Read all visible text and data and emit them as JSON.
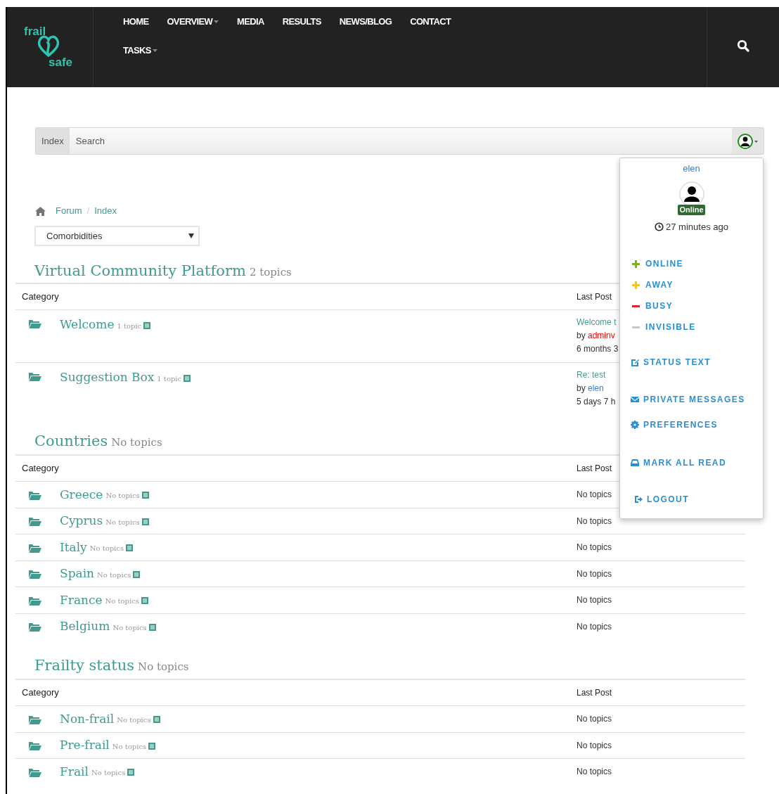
{
  "nav": {
    "items": [
      {
        "label": "HOME",
        "caret": false
      },
      {
        "label": "OVERVIEW",
        "caret": true
      },
      {
        "label": "MEDIA",
        "caret": false
      },
      {
        "label": "RESULTS",
        "caret": false
      },
      {
        "label": "NEWS/BLOG",
        "caret": false
      },
      {
        "label": "CONTACT",
        "caret": false
      },
      {
        "label": "TASKS",
        "caret": true
      }
    ],
    "logo": {
      "top": "frail",
      "bottom": "safe"
    }
  },
  "search": {
    "scope": "Index",
    "placeholder": "Search"
  },
  "breadcrumb": {
    "items": [
      "Forum",
      "Index"
    ],
    "separator": "/"
  },
  "category_select": {
    "value": "Comorbidities"
  },
  "user_menu": {
    "username": "elen",
    "badge": "Online",
    "last_seen": "27 minutes ago",
    "statuses": [
      {
        "label": "ONLINE",
        "color": "#7ab317"
      },
      {
        "label": "AWAY",
        "color": "#f5c518"
      },
      {
        "label": "BUSY",
        "color": "#e8202a"
      },
      {
        "label": "INVISIBLE",
        "color": "#c8c8c8"
      }
    ],
    "actions": [
      "STATUS TEXT",
      "PRIVATE MESSAGES",
      "PREFERENCES",
      "MARK ALL READ",
      "LOGOUT"
    ]
  },
  "sections": [
    {
      "title": "Virtual Community Platform",
      "count": "2 topics",
      "columns": [
        "Category",
        "Last Post"
      ],
      "rows": [
        {
          "name": "Welcome",
          "count": "1 topic",
          "last_post": {
            "title": "Welcome t",
            "by": "by",
            "user": "adminv",
            "color": "#ff0000",
            "time": "6 months 3"
          }
        },
        {
          "name": "Suggestion Box",
          "count": "1 topic",
          "last_post": {
            "title": "Re: test",
            "by": "by",
            "user": "elen",
            "color": "#3b7dc4",
            "time": "5 days 7 h"
          }
        }
      ]
    },
    {
      "title": "Countries",
      "count": "No topics",
      "columns": [
        "Category",
        "Last Post"
      ],
      "rows": [
        {
          "name": "Greece",
          "count": "No topics",
          "last_post_text": "No topics"
        },
        {
          "name": "Cyprus",
          "count": "No topics",
          "last_post_text": "No topics"
        },
        {
          "name": "Italy",
          "count": "No topics",
          "last_post_text": "No topics"
        },
        {
          "name": "Spain",
          "count": "No topics",
          "last_post_text": "No topics"
        },
        {
          "name": "France",
          "count": "No topics",
          "last_post_text": "No topics"
        },
        {
          "name": "Belgium",
          "count": "No topics",
          "last_post_text": "No topics"
        }
      ]
    },
    {
      "title": "Frailty status",
      "count": "No topics",
      "columns": [
        "Category",
        "Last Post"
      ],
      "rows": [
        {
          "name": "Non-frail",
          "count": "No topics",
          "last_post_text": "No topics"
        },
        {
          "name": "Pre-frail",
          "count": "No topics",
          "last_post_text": "No topics"
        },
        {
          "name": "Frail",
          "count": "No topics",
          "last_post_text": "No topics"
        }
      ]
    }
  ]
}
